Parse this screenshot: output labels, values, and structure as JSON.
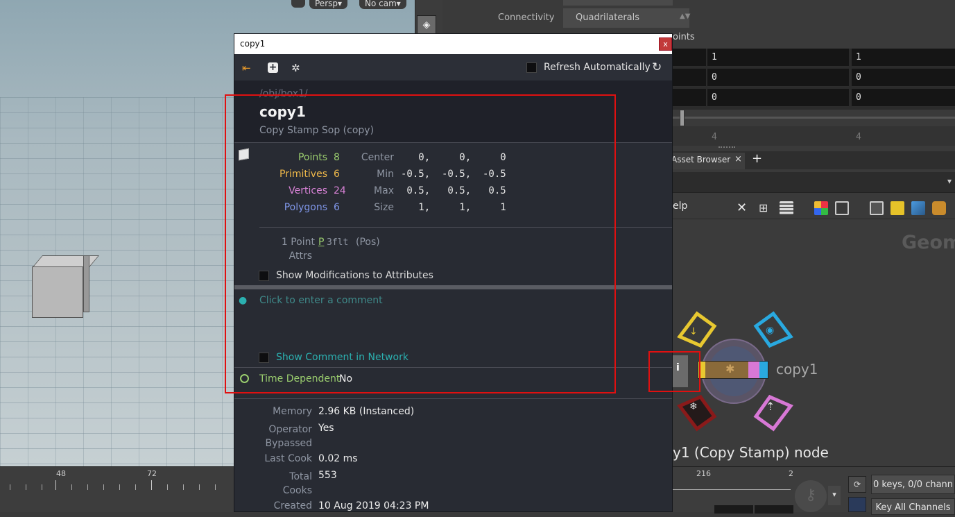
{
  "viewport": {
    "persp_label": "Persp",
    "cam_label": "No cam"
  },
  "timeline": {
    "labels": [
      "48",
      "72"
    ],
    "right_labels": [
      "216",
      "2"
    ]
  },
  "params": {
    "row_label": "Connectivity",
    "row_value": "Quadrilaterals",
    "col_header": "oints",
    "cells": [
      [
        "1",
        "1"
      ],
      [
        "0",
        "0"
      ],
      [
        "0",
        "0"
      ]
    ],
    "dim_cells": [
      "4",
      "4"
    ]
  },
  "tabs": {
    "asset_browser": "Asset Browser",
    "close": "×",
    "add": "+"
  },
  "toolbar2": {
    "help_text": "elp"
  },
  "network": {
    "watermark": "Geom",
    "node_name": "copy1",
    "node_caption": "y1 (Copy Stamp) node"
  },
  "bottom_right": {
    "keys_label": "0 keys, 0/0 chann",
    "key_all_label": "Key All Channels"
  },
  "info": {
    "window_title": "copy1",
    "close_glyph": "x",
    "refresh_label": "Refresh Automatically",
    "path": "/obj/box1/",
    "node_name": "copy1",
    "node_type": "Copy Stamp Sop (copy)",
    "counts": [
      {
        "label": "Points",
        "value": "8",
        "color": "#9acd6e"
      },
      {
        "label": "Primitives",
        "value": "6",
        "color": "#f0b94a"
      },
      {
        "label": "Vertices",
        "value": "24",
        "color": "#d882d6"
      },
      {
        "label": "Polygons",
        "value": "6",
        "color": "#7f96e8"
      }
    ],
    "bounds": [
      {
        "label": "Center",
        "value": "   0,     0,     0"
      },
      {
        "label": "Min",
        "value": "-0.5,  -0.5,  -0.5"
      },
      {
        "label": "Max",
        "value": " 0.5,   0.5,   0.5"
      },
      {
        "label": "Size",
        "value": "   1,     1,     1"
      }
    ],
    "attr_count": "1 Point",
    "attrs_word": "Attrs",
    "attr_name": "P",
    "attr_type": "3flt",
    "attr_desc": "(Pos)",
    "show_mods_label": "Show Modifications to Attributes",
    "comment_placeholder": "Click to enter a comment",
    "show_comment_label": "Show Comment in Network",
    "time_dep_label": "Time Dependent",
    "time_dep_value": "No",
    "stats": [
      {
        "label": "Memory",
        "value": "2.96 KB (Instanced)"
      },
      {
        "label": "Operator\nBypassed",
        "value": "Yes"
      },
      {
        "label": "Last Cook",
        "value": "0.02 ms"
      },
      {
        "label": "Total\nCooks",
        "value": "553"
      },
      {
        "label": "Created",
        "value": "10 Aug 2019 04:23 PM"
      }
    ]
  }
}
